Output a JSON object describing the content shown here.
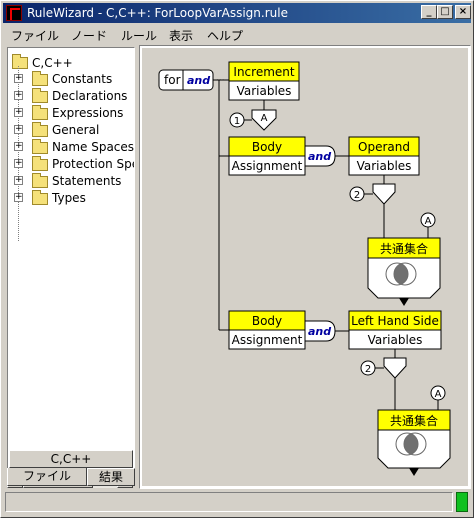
{
  "window": {
    "title": "RuleWizard - C,C++: ForLoopVarAssign.rule"
  },
  "titlebar_buttons": {
    "minimize": "_",
    "maximize": "□",
    "close": "×"
  },
  "menu": [
    "ファイル",
    "ノード",
    "ルール",
    "表示",
    "ヘルプ"
  ],
  "tree": {
    "root": "C,C++",
    "items": [
      "Constants",
      "Declarations",
      "Expressions",
      "General",
      "Name Spaces",
      "Protection Spe",
      "Statements",
      "Types"
    ],
    "expander_symbol": "+"
  },
  "scrollbar": {
    "left_arrow": "◀",
    "right_arrow": "▶"
  },
  "language_button": "C,C++",
  "tabs": [
    "ファイル",
    "結果"
  ],
  "diagram": {
    "for_label": "for",
    "and_label": "and",
    "increment": {
      "title": "Increment",
      "subtitle": "Variables"
    },
    "body1": {
      "title": "Body",
      "subtitle": "Assignment"
    },
    "operand": {
      "title": "Operand",
      "subtitle": "Variables"
    },
    "body2": {
      "title": "Body",
      "subtitle": "Assignment"
    },
    "lhs": {
      "title": "Left Hand Side",
      "subtitle": "Variables"
    },
    "intersection_label": "共通集合",
    "circle_1": "1",
    "circle_2": "2",
    "letter_a": "A"
  },
  "colors": {
    "node_header": "#ffff00",
    "and_text": "#0000a0",
    "status_led": "#10c020"
  }
}
